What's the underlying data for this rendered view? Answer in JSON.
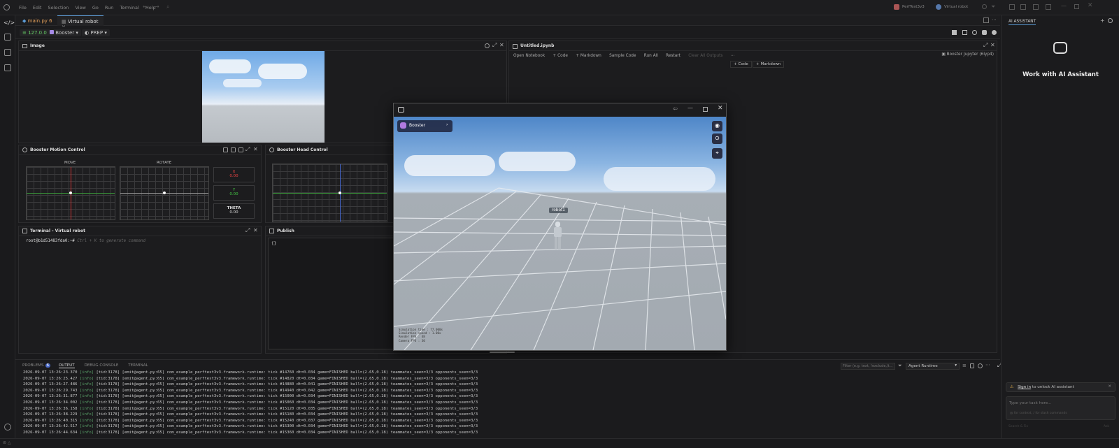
{
  "menu": [
    "File",
    "Edit",
    "Selection",
    "View",
    "Go",
    "Run",
    "Terminal",
    "Help"
  ],
  "titlebar": {
    "project": "PerfTest3v3",
    "robot": "Virtual robot"
  },
  "tabs": [
    {
      "label": "main.py",
      "badge": "6"
    },
    {
      "label": "Virtual robot"
    }
  ],
  "toolbar": {
    "ip": "127.0.0.1",
    "robot": "Booster",
    "mode": "PREP"
  },
  "image_panel": {
    "title": "Image"
  },
  "notebook": {
    "title": "Untitled.ipynb",
    "actions": [
      "Open Notebook",
      "+ Code",
      "+ Markdown",
      "Sample Code",
      "Run All",
      "Restart",
      "Clear All Outputs"
    ],
    "kernel": "Booster Jupyter (6lyp4)",
    "inline_add": [
      "+ Code",
      "+ Markdown"
    ]
  },
  "motion": {
    "title": "Booster Motion Control",
    "move": "MOVE",
    "rotate": "ROTATE",
    "x_label": "X",
    "x_val": "0.00",
    "y_label": "Y",
    "y_val": "0.00",
    "theta_label": "THETA",
    "theta_val": "0.00"
  },
  "head": {
    "title": "Booster Head Control"
  },
  "terminal": {
    "title": "Terminal - Virtual robot",
    "prompt": "root@b1d51483fda0:~#",
    "hint": "Ctrl + K to generate command"
  },
  "publish": {
    "title": "Publish",
    "content": "{}"
  },
  "sim": {
    "robot_label": "Booster",
    "robot_name": "robot1",
    "stats": [
      "Simulation time : 77.000s",
      "Simulation speed : 1.00x",
      "Render FPS : 48",
      "Camera FPS : 30"
    ]
  },
  "bottom": {
    "tabs": [
      "PROBLEMS",
      "OUTPUT",
      "DEBUG CONSOLE",
      "TERMINAL"
    ],
    "problems_count": "6",
    "filter_placeholder": "Filter (e.g. text, !exclude,\\t...)",
    "channel": "Agent Runtime"
  },
  "logs": [
    {
      "ts": "2026-09-07 13:26:23.370",
      "tick": "14760",
      "dt": "0.034"
    },
    {
      "ts": "2026-09-07 13:26:25.427",
      "tick": "14820",
      "dt": "0.034"
    },
    {
      "ts": "2026-09-07 13:26:27.486",
      "tick": "14880",
      "dt": "0.041"
    },
    {
      "ts": "2026-09-07 13:26:29.743",
      "tick": "14940",
      "dt": "0.042"
    },
    {
      "ts": "2026-09-07 13:26:31.877",
      "tick": "15000",
      "dt": "0.034"
    },
    {
      "ts": "2026-09-07 13:26:34.002",
      "tick": "15060",
      "dt": "0.034"
    },
    {
      "ts": "2026-09-07 13:26:36.158",
      "tick": "15120",
      "dt": "0.035"
    },
    {
      "ts": "2026-09-07 13:26:38.229",
      "tick": "15180",
      "dt": "0.034"
    },
    {
      "ts": "2026-09-07 13:26:40.315",
      "tick": "15240",
      "dt": "0.037"
    },
    {
      "ts": "2026-09-07 13:26:42.517",
      "tick": "15300",
      "dt": "0.034"
    },
    {
      "ts": "2026-09-07 13:26:44.634",
      "tick": "15360",
      "dt": "0.034"
    }
  ],
  "log_common": {
    "level": "[info]",
    "tid": "[tid:3178]",
    "src": "[emit@agent.py:65]",
    "body": "com_example_perftest3v3.framework.runtime: tick #",
    "tail": "game=FINISHED ball=(2.65,0.18) teammates_seen=3/3 opponents_seen=3/3"
  },
  "assistant": {
    "tab": "AI ASSISTANT",
    "heading": "Work with AI Assistant",
    "signin": "Sign in",
    "signin_rest": " to unlock AI assistant",
    "input_placeholder": "Type your task here...",
    "input_hint": "@ for context, / for slash commands",
    "footer": "Search & Fix",
    "footer_right": "Ask"
  }
}
